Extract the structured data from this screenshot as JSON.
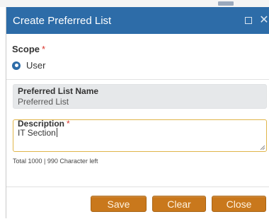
{
  "dialog": {
    "title": "Create Preferred List",
    "maximize_icon": "maximize-icon",
    "close_icon": "close-icon"
  },
  "scope": {
    "label": "Scope",
    "required_mark": "*",
    "option_label": "User",
    "selected": true
  },
  "name_field": {
    "label": "Preferred List Name",
    "value": "Preferred List"
  },
  "description_field": {
    "label": "Description",
    "required_mark": "*",
    "value": "IT Section"
  },
  "counter": "Total 1000 | 990 Character left",
  "buttons": {
    "save": "Save",
    "clear": "Clear",
    "close": "Close"
  },
  "colors": {
    "title_bar": "#2d6ca8",
    "button": "#c9781c",
    "required": "#d9342b",
    "focus_border": "#e0b54a"
  }
}
